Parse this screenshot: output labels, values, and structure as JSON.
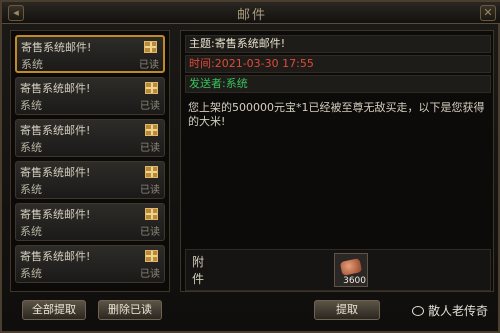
{
  "window": {
    "title": "邮件"
  },
  "mail_list": [
    {
      "subject": "寄售系统邮件!",
      "sender": "系统",
      "status": "已读",
      "selected": true
    },
    {
      "subject": "寄售系统邮件!",
      "sender": "系统",
      "status": "已读"
    },
    {
      "subject": "寄售系统邮件!",
      "sender": "系统",
      "status": "已读"
    },
    {
      "subject": "寄售系统邮件!",
      "sender": "系统",
      "status": "已读"
    },
    {
      "subject": "寄售系统邮件!",
      "sender": "系统",
      "status": "已读"
    },
    {
      "subject": "寄售系统邮件!",
      "sender": "系统",
      "status": "已读"
    }
  ],
  "detail": {
    "subject": "主题:寄售系统邮件!",
    "time": "时间:2021-03-30  17:55",
    "sender": "发送者:系统",
    "body": "您上架的500000元宝*1已经被至尊无敌买走，以下是您获得的大米!",
    "attachment_label": "附件",
    "attachment_qty": "3600"
  },
  "buttons": {
    "collect_all": "全部提取",
    "delete_read": "删除已读",
    "collect": "提取"
  },
  "watermark": "散人老传奇",
  "colors": {
    "time": "#e04a3a",
    "sender_line": "#37c25b",
    "subject_line": "#e8e1cf",
    "selected_border": "#c08a2a"
  }
}
